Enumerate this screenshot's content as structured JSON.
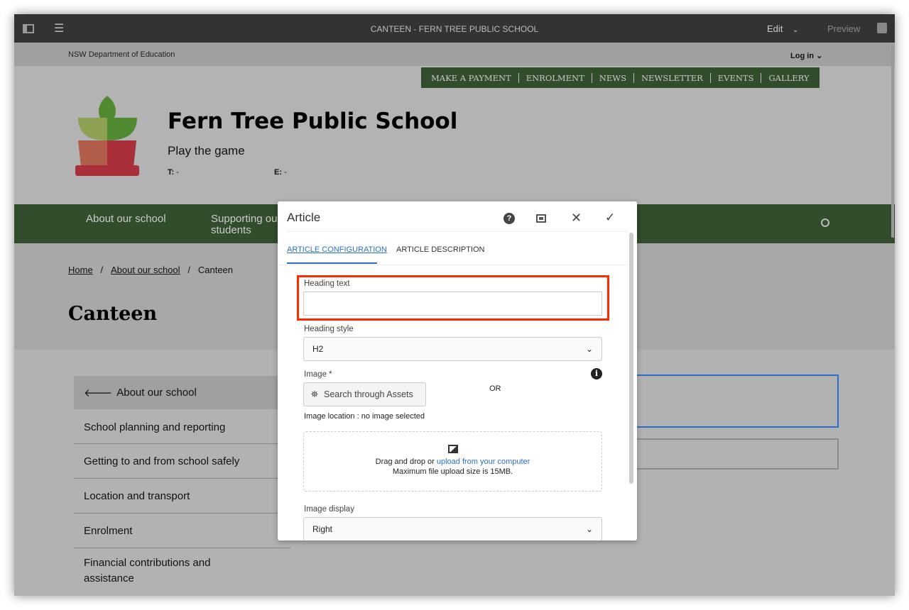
{
  "editor": {
    "title": "CANTEEN - FERN TREE PUBLIC SCHOOL",
    "mode": "Edit",
    "preview": "Preview"
  },
  "site": {
    "department": "NSW Department of Education",
    "login": "Log in",
    "quick_links": [
      "MAKE A PAYMENT",
      "ENROLMENT",
      "NEWS",
      "NEWSLETTER",
      "EVENTS",
      "GALLERY"
    ],
    "school_name": "Fern Tree Public School",
    "motto": "Play the game",
    "phone_label": "T:",
    "phone": "-",
    "email_label": "E:",
    "email": "-",
    "nav": [
      "About our school",
      "Supporting our students"
    ],
    "breadcrumb": [
      "Home",
      "About our school",
      "Canteen"
    ],
    "page_title": "Canteen",
    "side_back": "About our school",
    "side_items": [
      "School planning and reporting",
      "Getting to and from school safely",
      "Location and transport",
      "Enrolment",
      "Financial contributions and assistance"
    ]
  },
  "dialog": {
    "title": "Article",
    "tabs": [
      {
        "label": "ARTICLE CONFIGURATION",
        "active": true
      },
      {
        "label": "ARTICLE DESCRIPTION",
        "active": false
      }
    ],
    "heading_text_label": "Heading text",
    "heading_text_value": "",
    "heading_style_label": "Heading style",
    "heading_style_value": "H2",
    "image_label": "Image *",
    "search_assets": "Search through Assets",
    "or": "OR",
    "image_location": "Image location : no image selected",
    "drop_text": "Drag and drop or ",
    "upload_link": "upload from your computer",
    "max_size": "Maximum file upload size is 15MB.",
    "image_display_label": "Image display",
    "image_display_value": "Right"
  },
  "colors": {
    "highlight": "#ff2a00",
    "accent": "#2c6ecb",
    "nav_green": "#324d2b"
  }
}
